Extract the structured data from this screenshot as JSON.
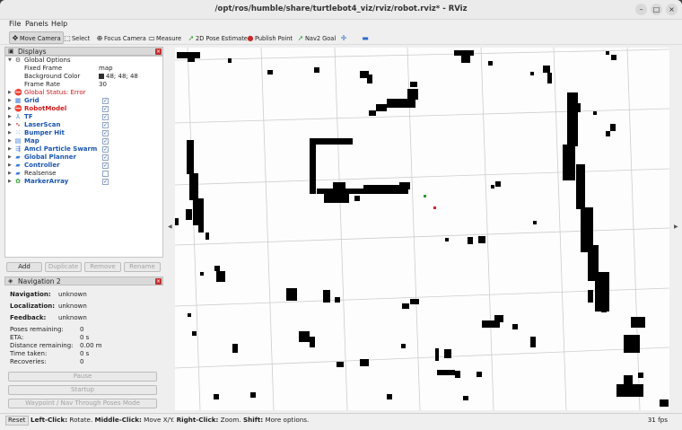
{
  "window": {
    "title": "/opt/ros/humble/share/turtlebot4_viz/rviz/robot.rviz* - RViz",
    "minimize": "–",
    "maximize": "□",
    "close": "×"
  },
  "menu": [
    "File",
    "Panels",
    "Help"
  ],
  "toolbar": {
    "move_camera": "Move Camera",
    "select": "Select",
    "focus_camera": "Focus Camera",
    "measure": "Measure",
    "pose_estimate": "2D Pose Estimate",
    "publish_point": "Publish Point",
    "nav2_goal": "Nav2 Goal"
  },
  "displays": {
    "title": "Displays",
    "global_options": "Global Options",
    "fixed_frame_label": "Fixed Frame",
    "fixed_frame_value": "map",
    "bg_color_label": "Background Color",
    "bg_color_value": "48; 48; 48",
    "frame_rate_label": "Frame Rate",
    "frame_rate_value": "30",
    "global_status": "Global Status: Error",
    "items": [
      {
        "name": "Grid",
        "checked": true
      },
      {
        "name": "RobotModel",
        "checked": true
      },
      {
        "name": "TF",
        "checked": true
      },
      {
        "name": "LaserScan",
        "checked": true
      },
      {
        "name": "Bumper Hit",
        "checked": true
      },
      {
        "name": "Map",
        "checked": true
      },
      {
        "name": "Amcl Particle Swarm",
        "checked": true
      },
      {
        "name": "Global Planner",
        "checked": true
      },
      {
        "name": "Controller",
        "checked": true
      },
      {
        "name": "Realsense",
        "checked": false
      },
      {
        "name": "MarkerArray",
        "checked": true
      }
    ],
    "buttons": {
      "add": "Add",
      "duplicate": "Duplicate",
      "remove": "Remove",
      "rename": "Rename"
    }
  },
  "nav2": {
    "title": "Navigation 2",
    "navigation_label": "Navigation:",
    "navigation_value": "unknown",
    "localization_label": "Localization:",
    "localization_value": "unknown",
    "feedback_label": "Feedback:",
    "feedback_value": "unknown",
    "poses_label": "Poses remaining:",
    "poses_value": "0",
    "eta_label": "ETA:",
    "eta_value": "0 s",
    "distance_label": "Distance remaining:",
    "distance_value": "0.00 m",
    "time_label": "Time taken:",
    "time_value": "0 s",
    "recoveries_label": "Recoveries:",
    "recoveries_value": "0",
    "pause": "Pause",
    "startup": "Startup",
    "waypoint_mode": "Waypoint / Nav Through Poses Mode"
  },
  "status": {
    "reset": "Reset",
    "left_click": "Left-Click:",
    "left_text": " Rotate. ",
    "middle_click": "Middle-Click:",
    "middle_text": " Move X/Y. ",
    "right_click": "Right-Click:",
    "right_text": " Zoom. ",
    "shift": "Shift:",
    "shift_text": " More options.",
    "fps": "31 fps"
  },
  "colors": {
    "map_bg": "#fdfdfd",
    "obstacle": "#000000",
    "grid": "#c9c9c9",
    "error": "#d01818",
    "link": "#1a55b0"
  }
}
